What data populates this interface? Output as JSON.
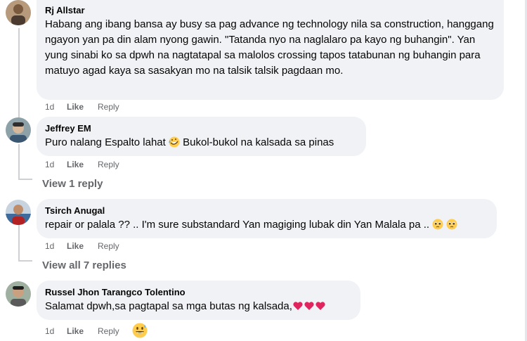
{
  "comments": [
    {
      "author": "Rj Allstar",
      "text": "Habang ang ibang bansa ay busy sa pag advance ng technology nila sa construction, hanggang ngayon yan pa din alam nyong gawin. \"Tatanda nyo na naglalaro pa kayo ng buhangin\". Yan yung sinabi ko sa dpwh na nagtatapal sa malolos crossing tapos tatabunan ng buhangin para matuyo agad kaya sa sasakyan mo na talsik talsik pagdaan mo.",
      "time": "1d",
      "like": "Like",
      "reply": "Reply"
    },
    {
      "author": "Jeffrey EM",
      "text_before": "Puro nalang Espalto lahat",
      "emoji": "rolling-laughing-face",
      "text_after": "Bukol-bukol na kalsada sa pinas",
      "time": "1d",
      "like": "Like",
      "reply": "Reply",
      "view_replies": "View 1 reply"
    },
    {
      "author": "Tsirch Anugal",
      "text": "repair or palala ?? .. I'm sure substandard Yan magiging lubak din Yan Malala pa ..",
      "emoji": "pleading-face",
      "time": "1d",
      "like": "Like",
      "reply": "Reply",
      "view_replies": "View all 7 replies"
    },
    {
      "author": "Russel Jhon Tarangco Tolentino",
      "text": "Salamat dpwh,sa pagtapal sa mga butas ng kalsada,",
      "emoji": "red-heart",
      "time": "1d",
      "like": "Like",
      "reply": "Reply",
      "reaction": "grinning-sweat-face"
    }
  ],
  "colors": {
    "bubble": "#f0f2f5",
    "secondary_text": "#65676b",
    "heart": "#e0245e",
    "emoji_yellow": "#ffcc4d"
  }
}
